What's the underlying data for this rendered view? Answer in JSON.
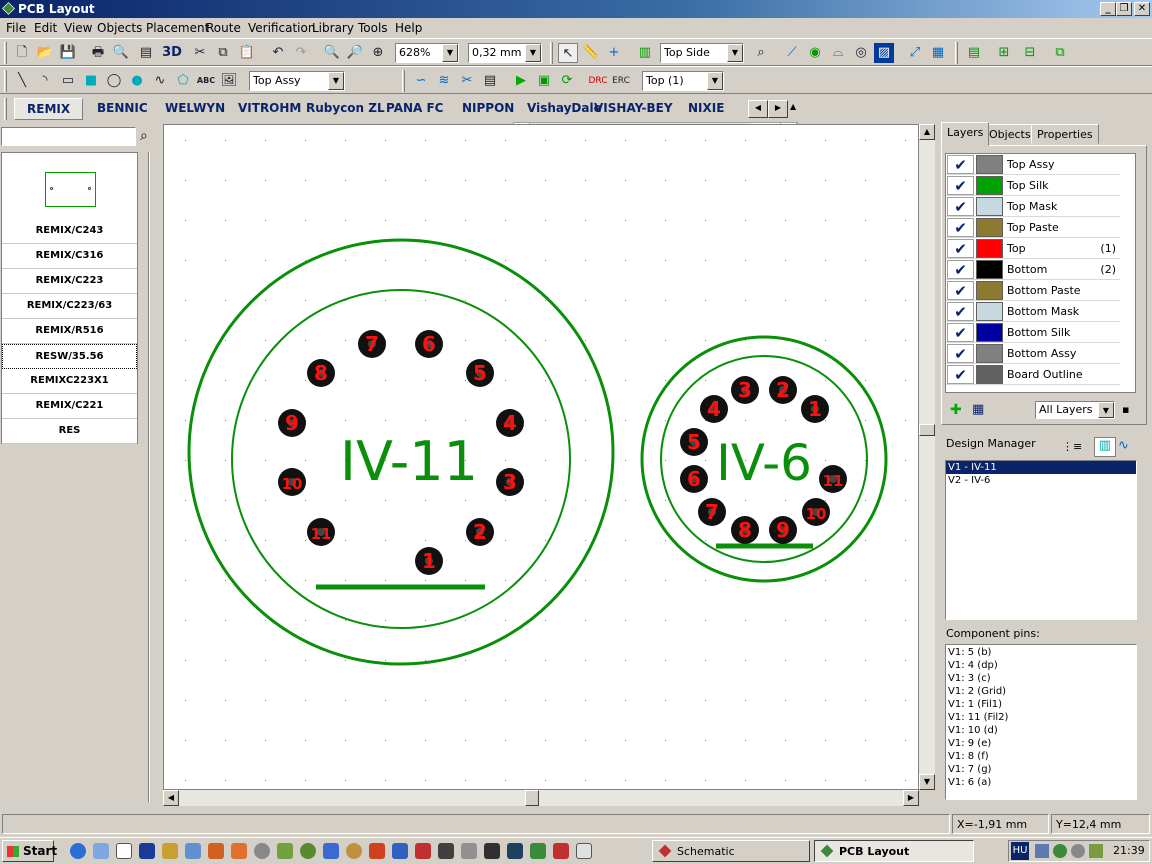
{
  "window": {
    "title": "PCB Layout"
  },
  "menu": [
    "File",
    "Edit",
    "View",
    "Objects",
    "Placement",
    "Route",
    "Verification",
    "Library",
    "Tools",
    "Help"
  ],
  "toolbar": {
    "btn_3d": "3D",
    "zoom_value": "628%",
    "grid_value": "0,32 mm",
    "side_value": "Top Side",
    "layer_value": "Top Assy",
    "route_layer_value": "Top (1)",
    "text_tool_label": "ABC"
  },
  "library_tabs": [
    "REMIX",
    "BENNIC",
    "WELWYN",
    "VITROHM",
    "Rubycon ZL",
    "PANA FC",
    "NIPPON",
    "VishayDale",
    "VISHAY-BEY",
    "NIXIE"
  ],
  "library_search": {
    "value": ""
  },
  "library_items": [
    "REMIX/C243",
    "REMIX/C316",
    "REMIX/C223",
    "REMIX/C223/63",
    "REMIX/R516",
    "RESW/35.56",
    "REMIXC223X1",
    "REMIX/C221",
    "RES"
  ],
  "canvas": {
    "component1": {
      "label": "IV-11",
      "pins": [
        "1",
        "2",
        "3",
        "4",
        "5",
        "6",
        "7",
        "8",
        "9",
        "10",
        "11"
      ]
    },
    "component2": {
      "label": "IV-6",
      "pins": [
        "1",
        "2",
        "3",
        "4",
        "5",
        "6",
        "7",
        "8",
        "9",
        "10",
        "11"
      ]
    }
  },
  "right_panel": {
    "tabs": [
      "Layers",
      "Objects",
      "Properties"
    ],
    "layers": [
      {
        "name": "Top Assy",
        "color": "#808080",
        "num": ""
      },
      {
        "name": "Top Silk",
        "color": "#00a000",
        "num": ""
      },
      {
        "name": "Top Mask",
        "color": "#c8d8e0",
        "num": ""
      },
      {
        "name": "Top Paste",
        "color": "#8c7a30",
        "num": ""
      },
      {
        "name": "Top",
        "color": "#ff0000",
        "num": "(1)"
      },
      {
        "name": "Bottom",
        "color": "#000000",
        "num": "(2)"
      },
      {
        "name": "Bottom Paste",
        "color": "#8c7a30",
        "num": ""
      },
      {
        "name": "Bottom Mask",
        "color": "#c8d8e0",
        "num": ""
      },
      {
        "name": "Bottom Silk",
        "color": "#0000a0",
        "num": ""
      },
      {
        "name": "Bottom Assy",
        "color": "#808080",
        "num": ""
      },
      {
        "name": "Board Outline",
        "color": "#606060",
        "num": ""
      }
    ],
    "layer_filter": "All Layers",
    "design_manager_label": "Design Manager",
    "design_items": [
      "V1 - IV-11",
      "V2 - IV-6"
    ],
    "component_pins_label": "Component pins:",
    "component_pins": [
      "V1: 5 (b)",
      "V1: 4 (dp)",
      "V1: 3 (c)",
      "V1: 2 (Grid)",
      "V1: 1 (Fil1)",
      "V1: 11 (Fil2)",
      "V1: 10 (d)",
      "V1: 9 (e)",
      "V1: 8 (f)",
      "V1: 7 (g)",
      "V1: 6 (a)"
    ]
  },
  "status": {
    "x": "X=-1,91 mm",
    "y": "Y=12,4 mm"
  },
  "taskbar": {
    "start": "Start",
    "tasks": [
      "Schematic",
      "PCB Layout"
    ],
    "lang": "HU",
    "clock": "21:39"
  }
}
